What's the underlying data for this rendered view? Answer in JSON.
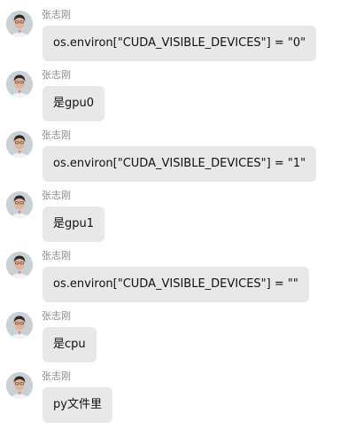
{
  "messages": [
    {
      "sender": "张志刚",
      "text": "os.environ[\"CUDA_VISIBLE_DEVICES\"] = \"0\""
    },
    {
      "sender": "张志刚",
      "text": "是gpu0"
    },
    {
      "sender": "张志刚",
      "text": "os.environ[\"CUDA_VISIBLE_DEVICES\"] = \"1\""
    },
    {
      "sender": "张志刚",
      "text": "是gpu1"
    },
    {
      "sender": "张志刚",
      "text": "os.environ[\"CUDA_VISIBLE_DEVICES\"] = \"\""
    },
    {
      "sender": "张志刚",
      "text": "是cpu"
    },
    {
      "sender": "张志刚",
      "text": "py文件里"
    }
  ],
  "colors": {
    "bubble": "#e8e8e8",
    "sender_name": "#8a8a8a",
    "message_text": "#111111",
    "background": "#ffffff"
  },
  "icons": {
    "avatar": "user-photo-avatar"
  }
}
